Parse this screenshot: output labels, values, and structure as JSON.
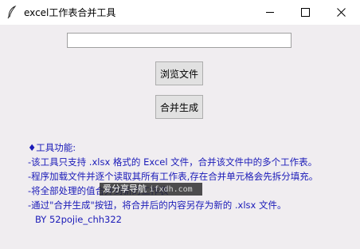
{
  "window": {
    "title": "excel工作表合并工具",
    "icon": "feather-pen-icon"
  },
  "controls": {
    "minimize_icon": "minimize-icon",
    "maximize_icon": "maximize-icon",
    "close_icon": "close-icon"
  },
  "main": {
    "path_entry": {
      "value": "",
      "placeholder": ""
    },
    "browse_label": "浏览文件",
    "merge_label": "合并生成"
  },
  "info": {
    "lines": [
      "♦工具功能:",
      "-该工具只支持 .xlsx 格式的 Excel 文件，合并该文件中的多个工作表。",
      "-程序加载文件并逐个读取其所有工作表,存在合并单元格会先拆分填充。",
      "-将全部处理的值合并到新的工作表",
      "-通过\"合并生成\"按钮，将合并后的内容另存为新的 .xlsx 文件。"
    ],
    "author": "BY 52pojie_chh322"
  },
  "watermark": {
    "text": "爱分享导航",
    "url": "ifxdh.com"
  },
  "colors": {
    "info_text": "#1a1ab8",
    "titlebar_bg": "#ffffff",
    "window_bg": "#f0edf0",
    "button_bg": "#e1e1e1"
  }
}
